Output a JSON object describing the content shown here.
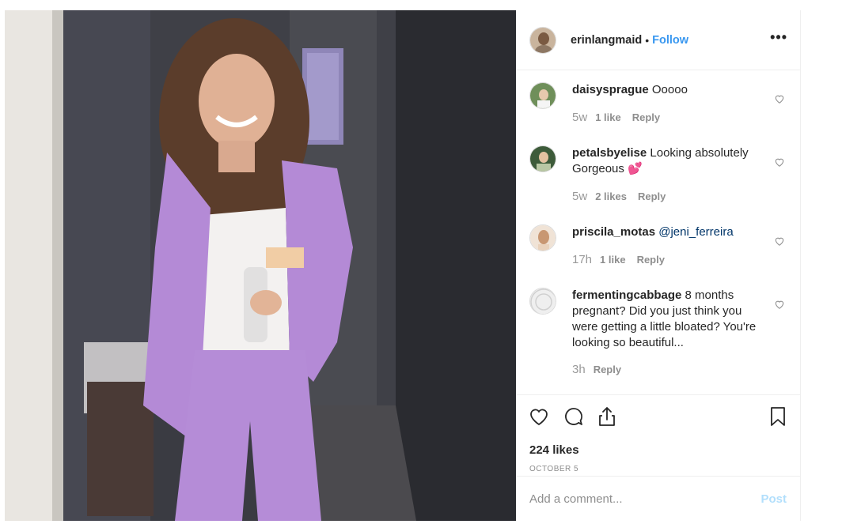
{
  "post": {
    "author": "erinlangmaid",
    "separator": "•",
    "follow_label": "Follow",
    "more_label": "•••",
    "likes_label": "224 likes",
    "date_label": "OCTOBER 5",
    "photo_icon": "photo-of-woman-in-lilac-suit"
  },
  "comments": [
    {
      "user": "daisysprague",
      "text": "Ooooo",
      "age": "5w",
      "likes": "1 like",
      "reply": "Reply"
    },
    {
      "user": "petalsbyelise",
      "text": "Looking absolutely Gorgeous 💕",
      "age": "5w",
      "likes": "2 likes",
      "reply": "Reply"
    },
    {
      "user": "priscila_motas",
      "text": "@jeni_ferreira",
      "age": "17h",
      "likes": "1 like",
      "reply": "Reply"
    },
    {
      "user": "fermentingcabbage",
      "text": "8 months pregnant? Did you just think you were getting a little bloated? You're looking so beautiful...",
      "age": "3h",
      "likes": "",
      "reply": "Reply"
    }
  ],
  "add_comment": {
    "placeholder": "Add a comment...",
    "post_label": "Post"
  },
  "colors": {
    "link": "#3897f0",
    "mention": "#003569",
    "muted": "#8e8e8e",
    "post_disabled": "#b2dffc",
    "suit": "#b48ad6"
  },
  "icons": [
    "heart-icon",
    "comment-icon",
    "share-icon",
    "bookmark-icon",
    "more-icon"
  ]
}
